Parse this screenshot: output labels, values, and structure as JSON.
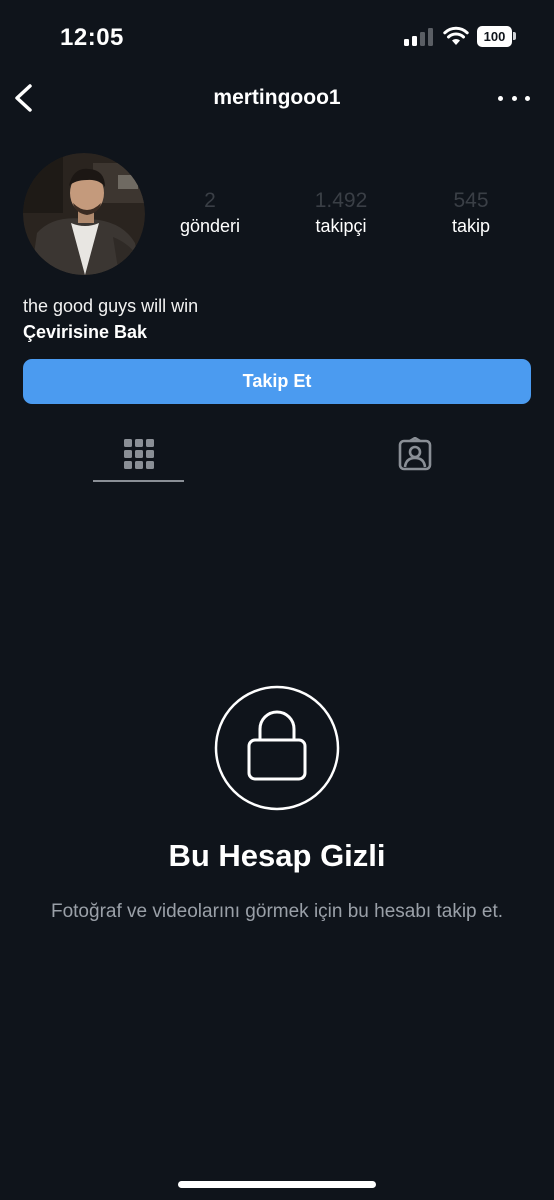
{
  "status_bar": {
    "time": "12:05",
    "battery": "100"
  },
  "header": {
    "username": "mertingooo1"
  },
  "stats": [
    {
      "value": "2",
      "label": "gönderi"
    },
    {
      "value": "1.492",
      "label": "takipçi"
    },
    {
      "value": "545",
      "label": "takip"
    }
  ],
  "bio": {
    "text": "the good guys will win",
    "translate_label": "Çevirisine Bak"
  },
  "follow_button": {
    "label": "Takip Et",
    "color": "#4b9bf0"
  },
  "tabs": [
    {
      "icon": "grid-icon",
      "active": true
    },
    {
      "icon": "tagged-person-icon",
      "active": false
    }
  ],
  "private_notice": {
    "icon": "lock-icon",
    "title": "Bu Hesap Gizli",
    "description": "Fotoğraf ve videolarını görmek için bu hesabı takip et."
  },
  "colors": {
    "background": "#0f141b",
    "accent": "#4b9bf0"
  }
}
